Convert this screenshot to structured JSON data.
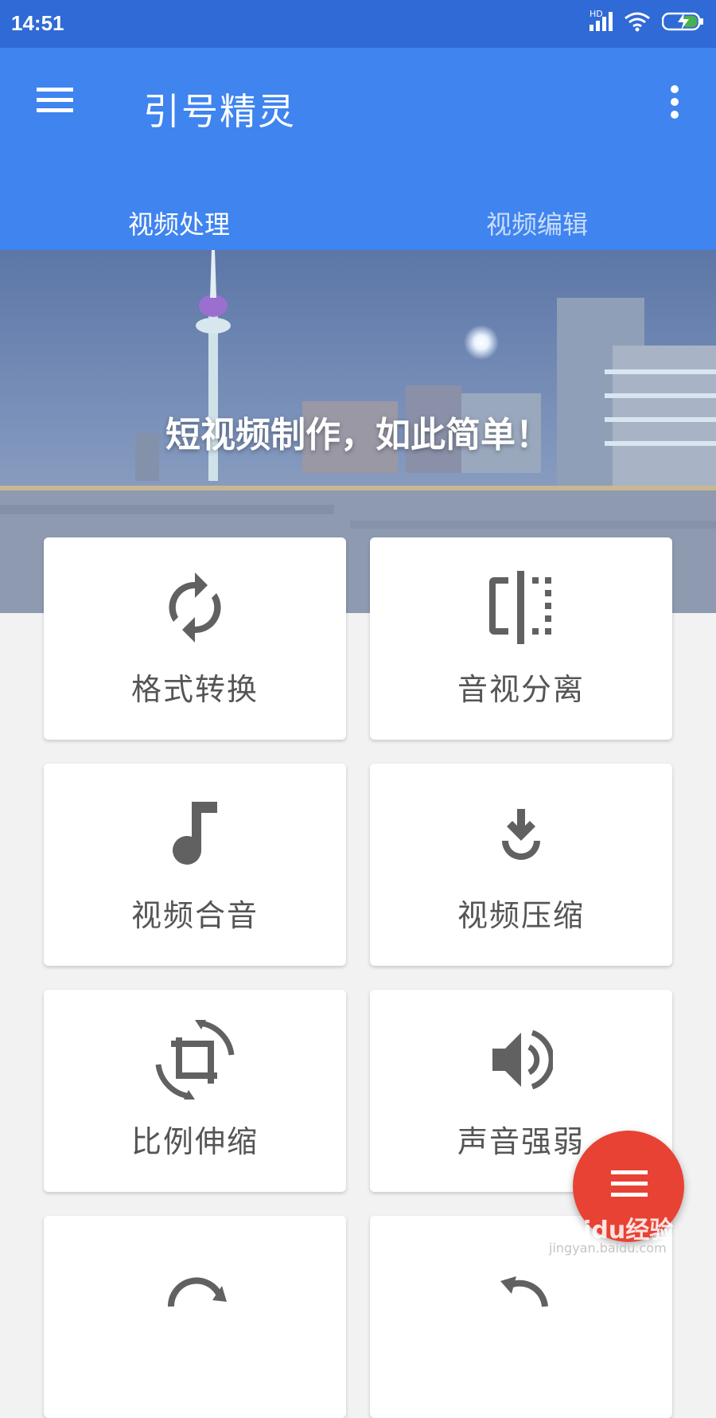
{
  "status_bar": {
    "time": "14:51",
    "network_label": "HD"
  },
  "app_bar": {
    "title": "引号精灵"
  },
  "tabs": [
    {
      "label": "视频处理",
      "active": true
    },
    {
      "label": "视频编辑",
      "active": false
    }
  ],
  "hero": {
    "slogan": "短视频制作，如此简单！"
  },
  "features": [
    {
      "label": "格式转换",
      "icon": "sync-icon"
    },
    {
      "label": "音视分离",
      "icon": "split-icon"
    },
    {
      "label": "视频合音",
      "icon": "music-note-icon"
    },
    {
      "label": "视频压缩",
      "icon": "download-icon"
    },
    {
      "label": "比例伸缩",
      "icon": "crop-rotate-icon"
    },
    {
      "label": "声音强弱",
      "icon": "volume-icon"
    }
  ],
  "watermark": {
    "brand": "Baidu经验",
    "url": "jingyan.baidu.com"
  },
  "colors": {
    "primary": "#3f84ef",
    "status_bar": "#2f6ad6",
    "indicator": "#e53935",
    "fab": "#e84234",
    "icon": "#616161"
  }
}
